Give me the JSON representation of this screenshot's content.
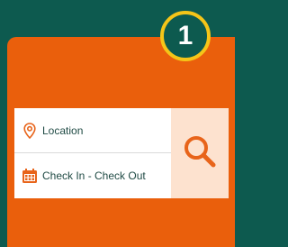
{
  "step_badge": {
    "number": "1"
  },
  "search": {
    "location_label": "Location",
    "dates_label": "Check In - Check Out",
    "icons": {
      "location": "map-pin-icon",
      "dates": "calendar-icon",
      "search": "search-icon"
    }
  },
  "colors": {
    "background": "#0d5a4f",
    "card": "#ea5f0c",
    "badge_ring": "#f5c518",
    "search_button_bg": "#fde2cf",
    "accent": "#e8641a"
  }
}
